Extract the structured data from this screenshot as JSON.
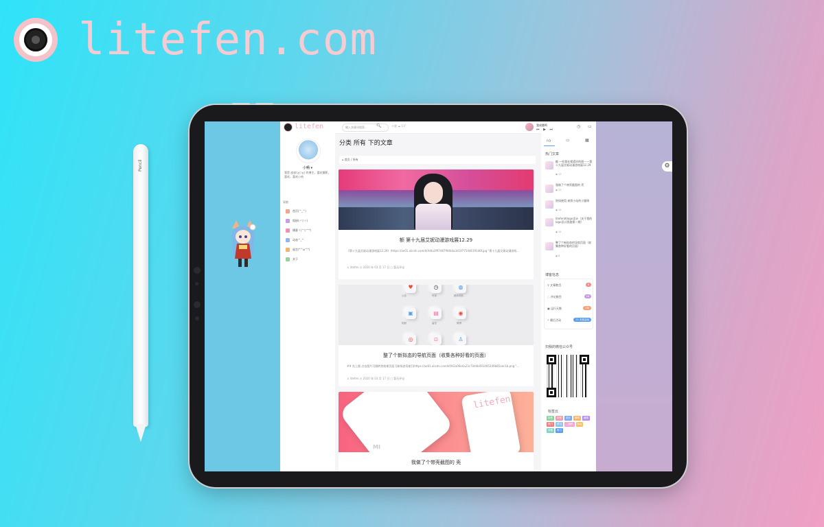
{
  "brand": {
    "name": "litefen.com"
  },
  "pencil": {
    "label": "Pencil"
  },
  "header": {
    "logo_text": "litefen",
    "search_placeholder": "输入关键词搜索...",
    "weather": "十度 ☁ 13°",
    "player_title": "我成雷鸣",
    "player_controls": "⏮ ▶ ⏭"
  },
  "profile": {
    "name": "小畅 ▾",
    "bio": "我是 皮皮(≧▽≦) 的博主，喜欢摄影，喜欢，喜欢小哈"
  },
  "nav": {
    "title": "导航",
    "items": [
      {
        "label": "首页(^_^)",
        "color": "#f6a38b"
      },
      {
        "label": "相册(〃▽〃)",
        "color": "#c79be6"
      },
      {
        "label": "播客ヾ(^▽^*)",
        "color": "#f48fb1"
      },
      {
        "label": "动态^_^",
        "color": "#8fb8f2"
      },
      {
        "label": "留言(*^ω^*)",
        "color": "#f2b56b"
      },
      {
        "label": "关于",
        "color": "#9ad19a"
      }
    ]
  },
  "main": {
    "page_title": "分类 所有 下的文章",
    "breadcrumb": "⌂ 首页 / 所有",
    "cards": [
      {
        "title": "额 第十九届艾妮动漫游戏展12.29",
        "excerpt": "《第十九届艾妮动漫游戏展12.29》(https://ae01.alicdn.com/kf/H4a3f97d87f94b4a3d19775446191d0f.jpg \"第十九届艾妮动漫游戏...",
        "meta": "♙ litefen   ◷ 2020 年 03 月 17 日   ◻ 暂无评论"
      },
      {
        "title": "整了个新拟态的导航页面（收集各种好看的页面）",
        "excerpt": "## 先上图 点击图片可跳转到效果页面 [[新拟态导航]](https://ae01.alicdn.com/kf/H2a06e4a23c70d4b4914652d9b85aac1b.png \"...",
        "meta": "♙ litefen   ◷ 2020 年 03 月 17 日   ◻ 暂无评论",
        "tiles": [
          "公告",
          "时钟",
          "跳转导航",
          "相册",
          "留言",
          "微博",
          "网易云",
          "哔哩",
          "QQ"
        ]
      },
      {
        "title": "我做了个带壳截图的 壳",
        "excerpt": "",
        "meta": ""
      }
    ]
  },
  "sidebar": {
    "hot_title": "热门文章",
    "hot": [
      {
        "title": "额 一些我在搜索时的图——第十九届艾妮动漫游戏展12.29",
        "views": "◉ 17"
      },
      {
        "title": "我做了个带壳截图的 壳",
        "views": "◉ 17"
      },
      {
        "title": "则如使用 来到小站的小猫咪",
        "views": "◉ 14"
      },
      {
        "title": "litefen的logo设计（关于我的logo设计思路第一期）",
        "views": "◉ 14"
      },
      {
        "title": "整了个新拟态的导航页面（收集各种好看的页面）",
        "views": "◉ 8"
      }
    ],
    "info_title": "博客信息",
    "stats": [
      {
        "label": "文章数目",
        "value": "8",
        "color": "#f48b8b"
      },
      {
        "label": "评论数目",
        "value": "16",
        "color": "#c79be6"
      },
      {
        "label": "运行天数",
        "value": "1年",
        "color": "#f4a27a"
      },
      {
        "label": "最后活动",
        "value": "21 天前活动",
        "color": "#5b9ef0"
      }
    ],
    "wechat_title": "扫我的微信公众号",
    "tags_title": "标签云",
    "tags": [
      {
        "text": "标签",
        "color": "#8fd19e"
      },
      {
        "text": "标签",
        "color": "#f29ab0"
      },
      {
        "text": "设计",
        "color": "#7fa9f0"
      },
      {
        "text": "新闻",
        "color": "#f5b26b"
      },
      {
        "text": "截图",
        "color": "#b48df0"
      },
      {
        "text": "热门",
        "color": "#f07f7f"
      },
      {
        "text": "学习",
        "color": "#8dc7f0"
      },
      {
        "text": "二维码",
        "color": "#f0a7d0"
      },
      {
        "text": "Bug",
        "color": "#f2c36b"
      },
      {
        "text": "风格",
        "color": "#7fd4c4"
      },
      {
        "text": "练习",
        "color": "#5a9ef0"
      }
    ]
  }
}
